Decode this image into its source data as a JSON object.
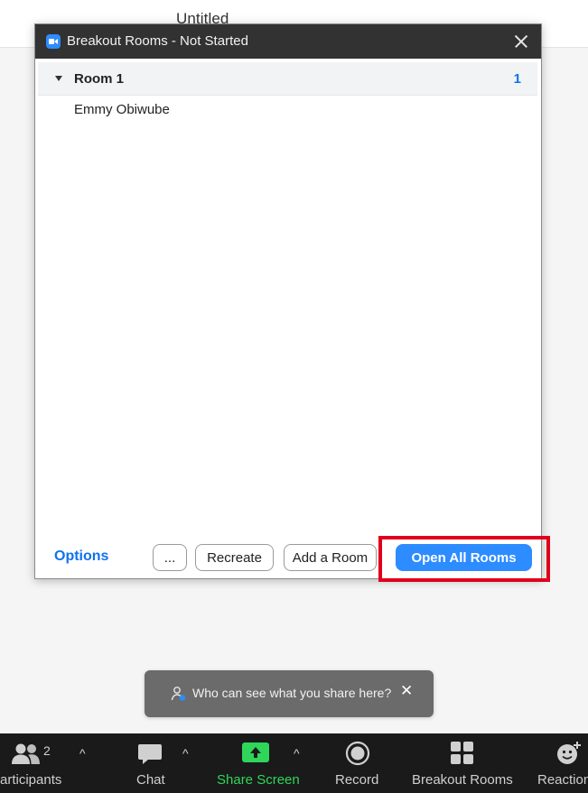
{
  "window": {
    "background_title": "Untitled"
  },
  "breakout": {
    "title": "Breakout Rooms - Not Started",
    "rooms": [
      {
        "name": "Room 1",
        "count": "1",
        "participants": [
          "Emmy Obiwube"
        ]
      }
    ],
    "options_label": "Options",
    "more_label": "...",
    "recreate_label": "Recreate",
    "add_room_label": "Add a Room",
    "open_all_label": "Open All Rooms"
  },
  "toast": {
    "text": "Who can see what you share here?",
    "close": "✕"
  },
  "toolbar": {
    "participants_label": "articipants",
    "participants_count": "2",
    "chat_label": "Chat",
    "share_label": "Share Screen",
    "record_label": "Record",
    "breakout_label": "Breakout Rooms",
    "reactions_label": "Reaction",
    "caret": "^"
  },
  "colors": {
    "accent": "#2d8cff",
    "link": "#0e72ed",
    "highlight": "#e0001b",
    "share_green": "#2fd65a",
    "toolbar_bg": "#1a1a1a",
    "titlebar_bg": "#323232"
  },
  "icons": {
    "zoom_logo": "zoom-logo-icon",
    "close": "close-icon",
    "caret": "caret-down-icon",
    "participants": "participants-icon",
    "chat": "chat-bubble-icon",
    "share": "share-arrow-icon",
    "record": "record-icon",
    "breakout": "grid-icon",
    "reactions": "smiley-plus-icon",
    "person": "person-icon"
  }
}
